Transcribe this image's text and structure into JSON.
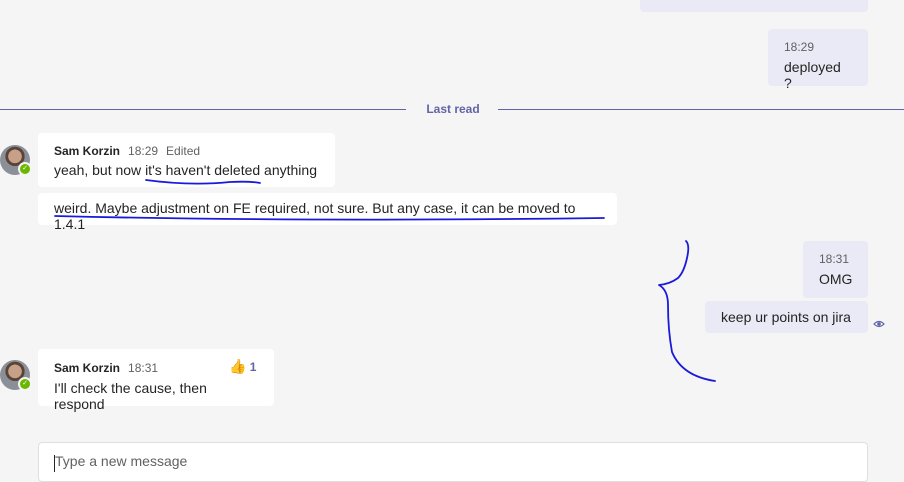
{
  "messages": {
    "own_top_partial": {},
    "own_deployed": {
      "time": "18:29",
      "text": "deployed ?"
    },
    "last_read_label": "Last read",
    "sam_1": {
      "author": "Sam Korzin",
      "time": "18:29",
      "edited": "Edited",
      "text_before": "yeah, but now ",
      "text_underlined": "it's haven't deleted",
      "text_after": " anything",
      "followup": "weird. Maybe adjustment on FE required, not sure. But any case, it can be moved to 1.4.1"
    },
    "own_omg": {
      "time": "18:31",
      "text": "OMG"
    },
    "own_jira": {
      "text": "keep ur points on jira"
    },
    "sam_2": {
      "author": "Sam Korzin",
      "time": "18:31",
      "text": "I'll check the cause, then respond",
      "reaction_icon": "thumbs-up-icon",
      "reaction_emoji": "👍",
      "reaction_count": "1"
    }
  },
  "compose": {
    "placeholder": "Type a new message"
  },
  "colors": {
    "accent": "#6264a7",
    "own_bubble": "#e9eaf6",
    "other_bubble": "#ffffff",
    "presence": "#6bb700",
    "annotation_ink": "#1a1adb"
  }
}
